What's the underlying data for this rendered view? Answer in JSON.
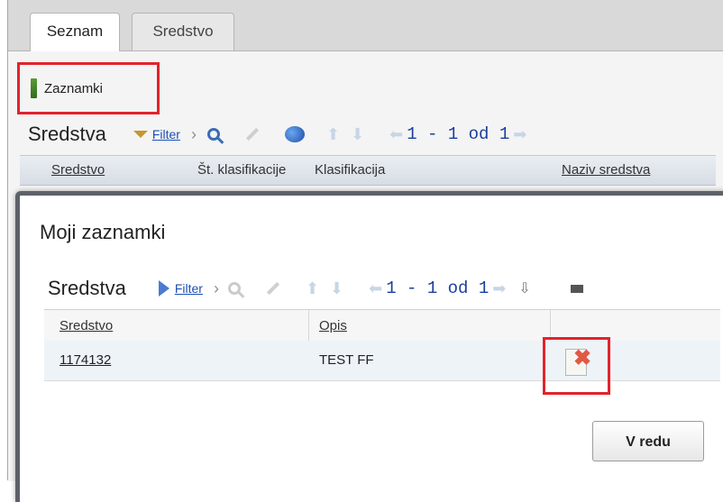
{
  "tabs": [
    {
      "label": "Seznam",
      "active": true
    },
    {
      "label": "Sredstvo",
      "active": false
    }
  ],
  "bookmarks_button": {
    "label": "Zaznamki",
    "icon": "bookmark-icon"
  },
  "main_toolbar": {
    "title": "Sredstva",
    "filter_label": "Filter",
    "pager": "1 - 1 od 1"
  },
  "main_columns": [
    "Sredstvo",
    "Št. klasifikacije",
    "Klasifikacija",
    "Naziv sredstva"
  ],
  "modal": {
    "title": "Moji zaznamki",
    "toolbar": {
      "title": "Sredstva",
      "filter_label": "Filter",
      "pager": "1 - 1 od 1"
    },
    "columns": [
      "Sredstvo",
      "Opis"
    ],
    "rows": [
      {
        "sredstvo": "1174132",
        "opis": "TEST FF"
      }
    ],
    "ok_label": "V redu"
  },
  "colors": {
    "highlight": "#e2232b",
    "link": "#1d4fb5",
    "pager_text": "#1c3e9c"
  }
}
